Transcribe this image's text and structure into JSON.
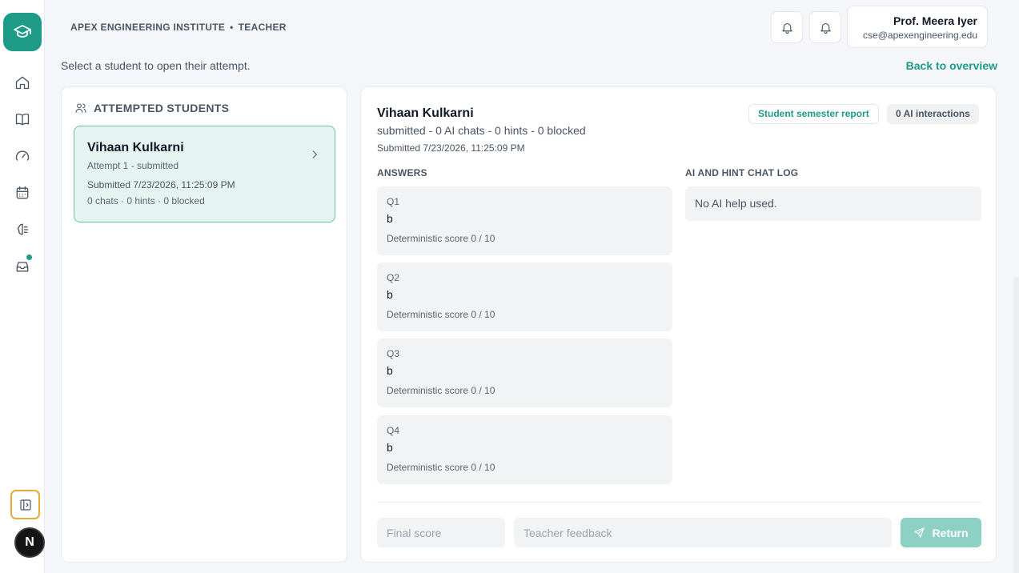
{
  "header": {
    "institute": "APEX ENGINEERING INSTITUTE",
    "separator": "•",
    "role": "TEACHER",
    "user_name": "Prof. Meera Iyer",
    "user_email": "cse@apexengineering.edu"
  },
  "page": {
    "hint": "Select a student to open their attempt.",
    "back_link": "Back to overview"
  },
  "left_panel": {
    "title": "ATTEMPTED STUDENTS",
    "students": [
      {
        "name": "Vihaan Kulkarni",
        "attempt": "Attempt 1 - submitted",
        "submitted": "Submitted 7/23/2026, 11:25:09 PM",
        "stats": "0 chats · 0 hints · 0 blocked"
      }
    ]
  },
  "detail": {
    "name": "Vihaan Kulkarni",
    "status": "submitted - 0 AI chats - 0 hints - 0 blocked",
    "submitted": "Submitted 7/23/2026, 11:25:09 PM",
    "report_button": "Student semester report",
    "ai_interactions": "0 AI interactions",
    "answers_label": "ANSWERS",
    "chat_label": "AI AND HINT CHAT LOG",
    "chat_empty": "No AI help used.",
    "answers": [
      {
        "q": "Q1",
        "a": "b",
        "score": "Deterministic score 0 / 10"
      },
      {
        "q": "Q2",
        "a": "b",
        "score": "Deterministic score 0 / 10"
      },
      {
        "q": "Q3",
        "a": "b",
        "score": "Deterministic score 0 / 10"
      },
      {
        "q": "Q4",
        "a": "b",
        "score": "Deterministic score 0 / 10"
      }
    ],
    "final_score_placeholder": "Final score",
    "feedback_placeholder": "Teacher feedback",
    "return_button": "Return"
  },
  "sidebar": {
    "logo": "Ν",
    "icons": [
      "graduation-cap-icon",
      "home-icon",
      "book-icon",
      "gauge-icon",
      "calendar-icon",
      "brain-icon",
      "inbox-icon",
      "sidebar-toggle-icon"
    ]
  },
  "colors": {
    "accent": "#1e9b86",
    "accent_light": "#e6f4f1",
    "return_disabled": "#8fd0c4"
  }
}
